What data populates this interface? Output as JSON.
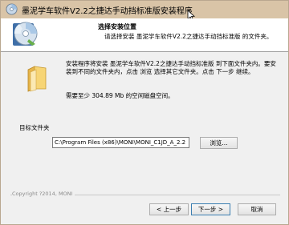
{
  "window": {
    "title": "墨泥学车软件V2.2之捷达手动挡标准版安装程序"
  },
  "header": {
    "title": "选择安装位置",
    "description": "请选择安装 墨泥学车软件V2.2之捷达手动挡标准版 的文件夹。"
  },
  "body": {
    "info": "安装程序将安装 墨泥学车软件V2.2之捷达手动挡标准版 到下面文件夹内。要安装到不同的文件夹内，点击 浏览 选择其它文件夹。点击 下一步 继续。",
    "space_required": "需要至少 304.89 Mb 的空闲磁盘空间。"
  },
  "destination": {
    "label": "目标文件夹",
    "path": "C:\\Program Files (x86)\\MONI\\MONI_C1JD_A_2.2",
    "browse_label": "浏览..."
  },
  "footer": {
    "copyright": "Copyright ?2014, MONI",
    "back_label": "< 上一步",
    "next_label": "下一步 >",
    "cancel_label": "取消"
  },
  "icons": {
    "app": "installer-cd-icon",
    "header": "cd-disc-icon",
    "folder": "folder-icon",
    "cursor": "mouse-cursor-icon"
  }
}
